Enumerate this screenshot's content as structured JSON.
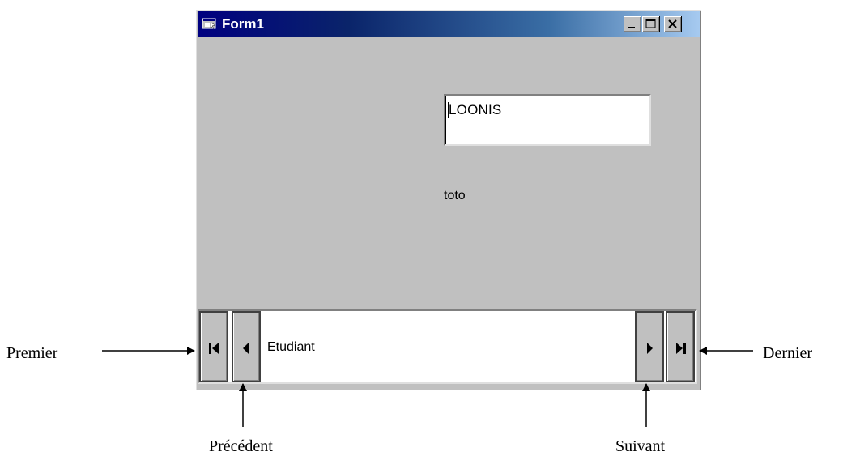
{
  "window": {
    "title": "Form1",
    "icons": {
      "app": "form-app-icon",
      "minimize": "minimize-icon",
      "maximize": "maximize-icon",
      "close": "close-icon"
    }
  },
  "form": {
    "textbox_value": "LOONIS",
    "label_text": "toto"
  },
  "data_control": {
    "caption": "Etudiant",
    "buttons": {
      "first": "first-record-icon",
      "previous": "previous-record-icon",
      "next": "next-record-icon",
      "last": "last-record-icon"
    }
  },
  "annotations": {
    "premier": "Premier",
    "precedent": "Précédent",
    "suivant": "Suivant",
    "dernier": "Dernier"
  }
}
